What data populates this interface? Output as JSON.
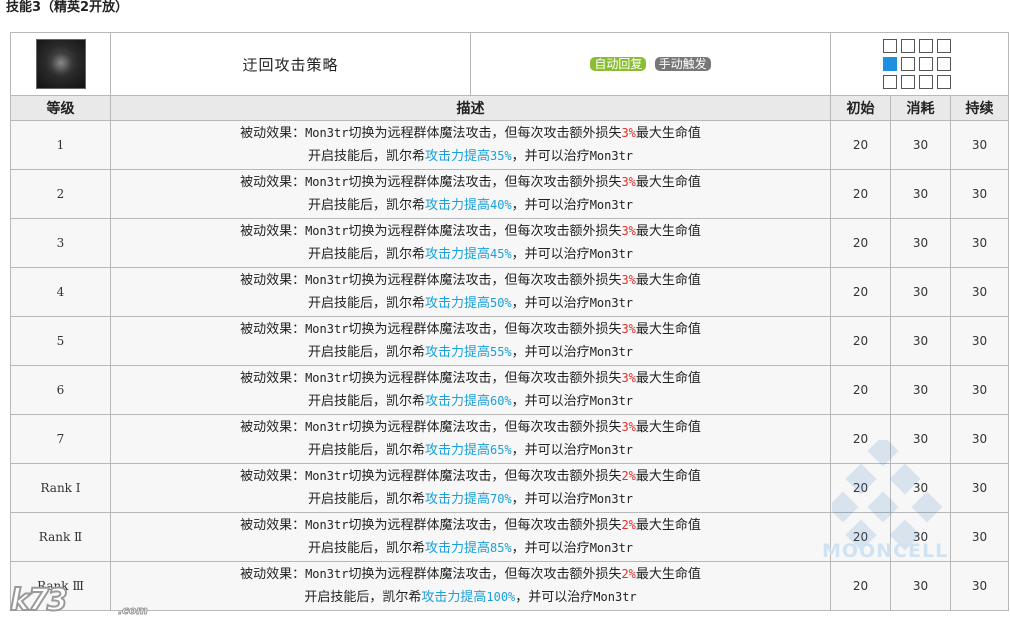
{
  "section_title": "技能3（精英2开放）",
  "skill": {
    "icon": "skill-icon-dark-beast",
    "name": "迂回攻击策略",
    "recovery_tag": "自动回复",
    "trigger_tag": "手动触发",
    "range_icon": "attack-range-grid"
  },
  "columns": {
    "level": "等级",
    "description": "描述",
    "initial": "初始",
    "cost": "消耗",
    "duration": "持续"
  },
  "rows": [
    {
      "level": "1",
      "d1": "被动效果：",
      "d2": "Mon3tr",
      "d3": "切换为远程群体魔法攻击，但每次攻击额外损失",
      "d4": "3%",
      "d5": "最大生命值",
      "e1": "开启技能后，凯尔希",
      "e2": "攻击力提高",
      "e3": "35%",
      "e4": "，并可以治疗",
      "e5": "Mon3tr",
      "initial": "20",
      "cost": "30",
      "duration": "30"
    },
    {
      "level": "2",
      "d1": "被动效果：",
      "d2": "Mon3tr",
      "d3": "切换为远程群体魔法攻击，但每次攻击额外损失",
      "d4": "3%",
      "d5": "最大生命值",
      "e1": "开启技能后，凯尔希",
      "e2": "攻击力提高",
      "e3": "40%",
      "e4": "，并可以治疗",
      "e5": "Mon3tr",
      "initial": "20",
      "cost": "30",
      "duration": "30"
    },
    {
      "level": "3",
      "d1": "被动效果：",
      "d2": "Mon3tr",
      "d3": "切换为远程群体魔法攻击，但每次攻击额外损失",
      "d4": "3%",
      "d5": "最大生命值",
      "e1": "开启技能后，凯尔希",
      "e2": "攻击力提高",
      "e3": "45%",
      "e4": "，并可以治疗",
      "e5": "Mon3tr",
      "initial": "20",
      "cost": "30",
      "duration": "30"
    },
    {
      "level": "4",
      "d1": "被动效果：",
      "d2": "Mon3tr",
      "d3": "切换为远程群体魔法攻击，但每次攻击额外损失",
      "d4": "3%",
      "d5": "最大生命值",
      "e1": "开启技能后，凯尔希",
      "e2": "攻击力提高",
      "e3": "50%",
      "e4": "，并可以治疗",
      "e5": "Mon3tr",
      "initial": "20",
      "cost": "30",
      "duration": "30"
    },
    {
      "level": "5",
      "d1": "被动效果：",
      "d2": "Mon3tr",
      "d3": "切换为远程群体魔法攻击，但每次攻击额外损失",
      "d4": "3%",
      "d5": "最大生命值",
      "e1": "开启技能后，凯尔希",
      "e2": "攻击力提高",
      "e3": "55%",
      "e4": "，并可以治疗",
      "e5": "Mon3tr",
      "initial": "20",
      "cost": "30",
      "duration": "30"
    },
    {
      "level": "6",
      "d1": "被动效果：",
      "d2": "Mon3tr",
      "d3": "切换为远程群体魔法攻击，但每次攻击额外损失",
      "d4": "3%",
      "d5": "最大生命值",
      "e1": "开启技能后，凯尔希",
      "e2": "攻击力提高",
      "e3": "60%",
      "e4": "，并可以治疗",
      "e5": "Mon3tr",
      "initial": "20",
      "cost": "30",
      "duration": "30"
    },
    {
      "level": "7",
      "d1": "被动效果：",
      "d2": "Mon3tr",
      "d3": "切换为远程群体魔法攻击，但每次攻击额外损失",
      "d4": "3%",
      "d5": "最大生命值",
      "e1": "开启技能后，凯尔希",
      "e2": "攻击力提高",
      "e3": "65%",
      "e4": "，并可以治疗",
      "e5": "Mon3tr",
      "initial": "20",
      "cost": "30",
      "duration": "30"
    },
    {
      "level": "Rank Ⅰ",
      "d1": "被动效果：",
      "d2": "Mon3tr",
      "d3": "切换为远程群体魔法攻击，但每次攻击额外损失",
      "d4": "2%",
      "d5": "最大生命值",
      "e1": "开启技能后，凯尔希",
      "e2": "攻击力提高",
      "e3": "70%",
      "e4": "，并可以治疗",
      "e5": "Mon3tr",
      "initial": "20",
      "cost": "30",
      "duration": "30"
    },
    {
      "level": "Rank Ⅱ",
      "d1": "被动效果：",
      "d2": "Mon3tr",
      "d3": "切换为远程群体魔法攻击，但每次攻击额外损失",
      "d4": "2%",
      "d5": "最大生命值",
      "e1": "开启技能后，凯尔希",
      "e2": "攻击力提高",
      "e3": "85%",
      "e4": "，并可以治疗",
      "e5": "Mon3tr",
      "initial": "20",
      "cost": "30",
      "duration": "30"
    },
    {
      "level": "Rank Ⅲ",
      "d1": "被动效果：",
      "d2": "Mon3tr",
      "d3": "切换为远程群体魔法攻击，但每次攻击额外损失",
      "d4": "2%",
      "d5": "最大生命值",
      "e1": "开启技能后，凯尔希",
      "e2": "攻击力提高",
      "e3": "100%",
      "e4": "，并可以治疗",
      "e5": "Mon3tr",
      "initial": "20",
      "cost": "30",
      "duration": "30"
    }
  ],
  "colors": {
    "highlight_red": "#e0302a",
    "highlight_blue": "#1aa0d8",
    "tag_green": "#8bbd32",
    "tag_gray": "#777777",
    "range_active": "#1e90e0",
    "header_bg": "#e9e9e9",
    "row_bg": "#f7f7f7"
  },
  "watermarks": {
    "site_logo": "k73",
    "corner_text": "MOONCELL"
  }
}
